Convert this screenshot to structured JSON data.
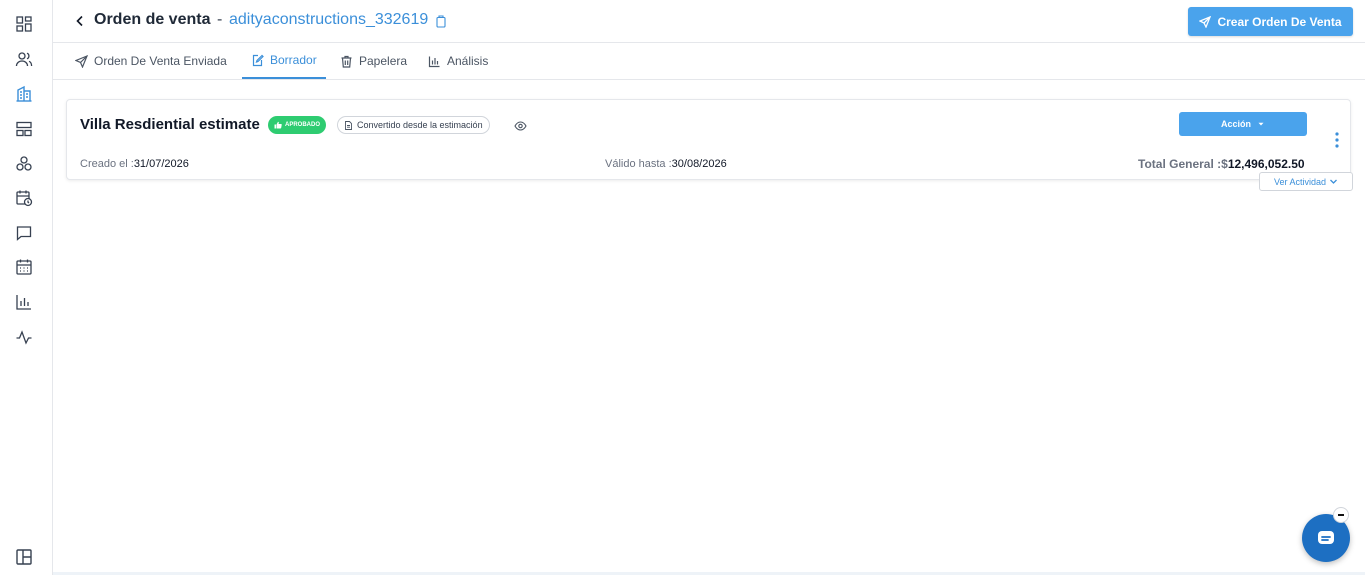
{
  "sidebar": {
    "items": [
      {
        "name": "dashboard-icon",
        "active": false
      },
      {
        "name": "users-icon",
        "active": false
      },
      {
        "name": "building-icon",
        "active": true
      },
      {
        "name": "layout-icon",
        "active": false
      },
      {
        "name": "modules-icon",
        "active": false
      },
      {
        "name": "calendar-clock-icon",
        "active": false
      },
      {
        "name": "chat-icon",
        "active": false
      },
      {
        "name": "calendar-icon",
        "active": false
      },
      {
        "name": "bar-chart-icon",
        "active": false
      },
      {
        "name": "activity-icon",
        "active": false
      }
    ],
    "footer_icon": "panel-layout-icon"
  },
  "header": {
    "title": "Orden de venta",
    "separator": "-",
    "company": "adityaconstructions_332619",
    "create_button": "Crear Orden De Venta"
  },
  "tabs": [
    {
      "label": "Orden De Venta Enviada",
      "icon": "send-icon",
      "active": false
    },
    {
      "label": "Borrador",
      "icon": "edit-icon",
      "active": true
    },
    {
      "label": "Papelera",
      "icon": "trash-icon",
      "active": false
    },
    {
      "label": "Análisis",
      "icon": "bar-chart-icon",
      "active": false
    }
  ],
  "order_card": {
    "title": "Villa Resdiential estimate",
    "status_badge": "APROBADO",
    "source_badge": "Convertido desde la estimación",
    "action_button": "Acción",
    "created_label": "Creado el :",
    "created_value": "31/07/2026",
    "valid_label": "Válido hasta :",
    "valid_value": "30/08/2026",
    "total_label": "Total General :",
    "total_currency": "$",
    "total_value": "12,496,052.50",
    "activity_button": "Ver Actividad"
  },
  "colors": {
    "accent": "#4aa3ec",
    "link": "#3b8fd9",
    "approved": "#2ecc71",
    "chat": "#1d6fc2"
  }
}
